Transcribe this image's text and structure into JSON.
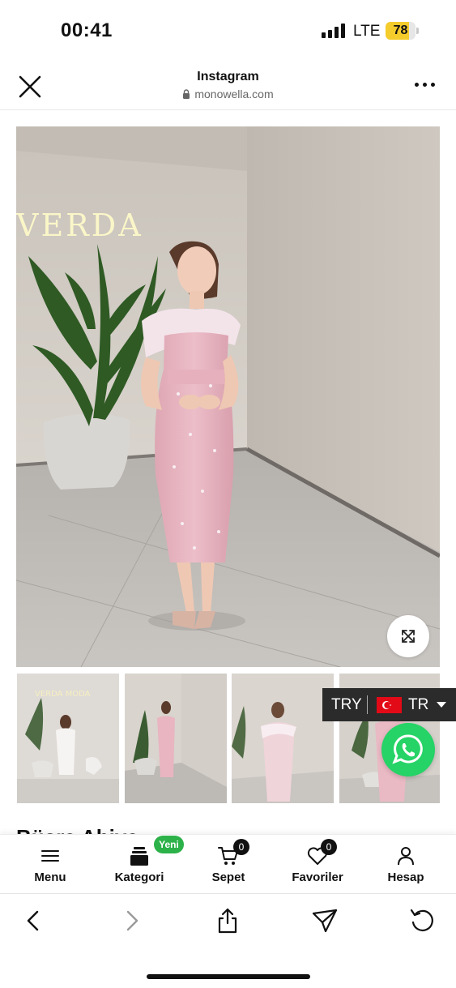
{
  "status_bar": {
    "time": "00:41",
    "network": "LTE",
    "battery": "78",
    "battery_level": 0.78,
    "battery_color": "#f4cc2c"
  },
  "browser_header": {
    "title": "Instagram",
    "url": "monowella.com",
    "close_icon": "close-icon",
    "more_icon": "more-icon"
  },
  "gallery": {
    "main_logo": "VERDA",
    "thumb_logo": "VERDA MODA",
    "expand_icon": "expand-icon",
    "dress_color": "#e9b9c4"
  },
  "currency": {
    "code": "TRY",
    "separator": "|",
    "language": "TR",
    "flag_icon": "turkey-flag-icon"
  },
  "whatsapp": {
    "icon": "whatsapp-icon",
    "color": "#25d366"
  },
  "product": {
    "title_peek": "Büşra Abiye"
  },
  "bottom_nav": {
    "items": [
      {
        "label": "Menu",
        "icon": "menu-icon"
      },
      {
        "label": "Kategori",
        "icon": "category-icon",
        "badge": "Yeni"
      },
      {
        "label": "Sepet",
        "icon": "cart-icon",
        "count": "0"
      },
      {
        "label": "Favoriler",
        "icon": "heart-icon",
        "count": "0"
      },
      {
        "label": "Hesap",
        "icon": "user-icon"
      }
    ],
    "badge_color": "#2db24a"
  },
  "browser_toolbar": {
    "icons": [
      "back-icon",
      "forward-icon",
      "share-icon",
      "send-icon",
      "reload-icon"
    ]
  }
}
